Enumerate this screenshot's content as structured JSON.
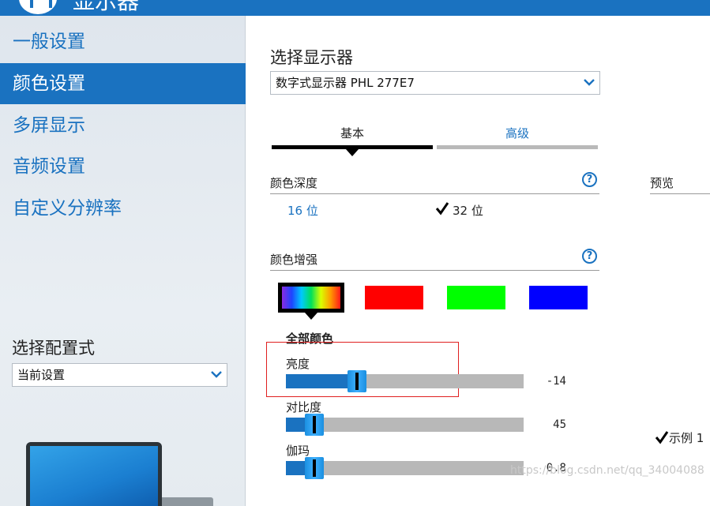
{
  "window": {
    "title": "显示器"
  },
  "sidebar": {
    "items": [
      {
        "label": "一般设置",
        "active": false
      },
      {
        "label": "颜色设置",
        "active": true
      },
      {
        "label": "多屏显示",
        "active": false
      },
      {
        "label": "音频设置",
        "active": false
      },
      {
        "label": "自定义分辨率",
        "active": false
      }
    ],
    "profile": {
      "title": "选择配置式",
      "selected": "当前设置"
    }
  },
  "main": {
    "display_select": {
      "title": "选择显示器",
      "selected": "数字式显示器 PHL 277E7"
    },
    "tabs": [
      {
        "label": "基本",
        "active": true
      },
      {
        "label": "高级",
        "active": false
      }
    ],
    "color_depth": {
      "title": "颜色深度",
      "help": "?",
      "options": [
        {
          "label": "16 位",
          "selected": false
        },
        {
          "label": "32 位",
          "selected": true
        }
      ]
    },
    "preview": {
      "title": "预览"
    },
    "color_enhance": {
      "title": "颜色增强",
      "help": "?",
      "swatches": [
        {
          "name": "all",
          "selected": true
        },
        {
          "name": "red",
          "color": "#ff0000"
        },
        {
          "name": "green",
          "color": "#00ff00"
        },
        {
          "name": "blue",
          "color": "#0000ff"
        }
      ],
      "channel_label": "全部颜色",
      "sliders": [
        {
          "label": "亮度",
          "value": "-14",
          "fraction": 0.3
        },
        {
          "label": "对比度",
          "value": "45",
          "fraction": 0.12
        },
        {
          "label": "伽玛",
          "value": "0.8",
          "fraction": 0.12
        }
      ]
    },
    "sample": {
      "label": "示例 1"
    },
    "watermark": "https://blog.csdn.net/qq_34004088"
  },
  "colors": {
    "accent": "#1a72c0",
    "highlight": "#e02020"
  }
}
